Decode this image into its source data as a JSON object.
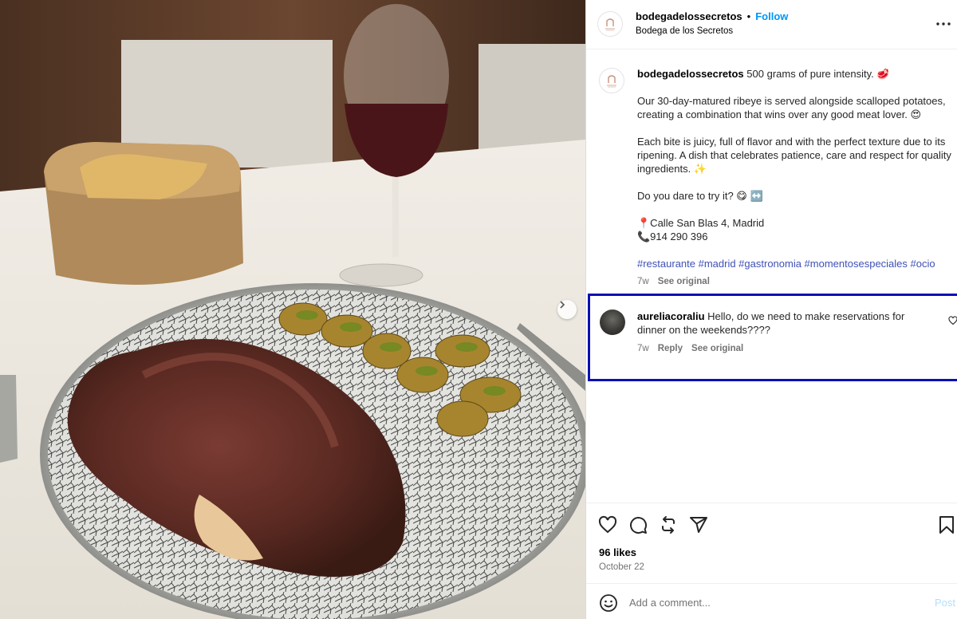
{
  "post": {
    "username": "bodegadelossecretos",
    "separator": "•",
    "follow_label": "Follow",
    "location": "Bodega de los Secretos",
    "more_icon": "more-horizontal-icon"
  },
  "caption": {
    "username": "bodegadelossecretos",
    "first_line": "500 grams of pure intensity. 🥩",
    "para1": "Our 30-day-matured ribeye is served alongside scalloped potatoes, creating a combination that wins over any good meat lover. 😍",
    "para2": "Each bite is juicy, full of flavor and with the perfect texture due to its ripening. A dish that celebrates patience, care and respect for quality ingredients. ✨",
    "para3": "Do you dare to try it? 😋 ↔️",
    "address": "📍Calle San Blas 4, Madrid",
    "phone": "📞914 290 396",
    "hashtags": "#restaurante #madrid #gastronomia #momentosespeciales #ocio",
    "time": "7w",
    "see_original": "See original"
  },
  "comment": {
    "username": "aureliacoraliu",
    "text": "Hello, do we need to make reservations for dinner on the weekends????",
    "time": "7w",
    "reply": "Reply",
    "see_original": "See original"
  },
  "actions": {
    "icons": [
      "heart-icon",
      "comment-icon",
      "repost-icon",
      "share-icon",
      "bookmark-icon"
    ],
    "likes": "96 likes",
    "date": "October 22"
  },
  "add_comment": {
    "placeholder": "Add a comment...",
    "post_label": "Post"
  },
  "colors": {
    "accent": "#0095f6",
    "highlight_border": "#0a0fb5",
    "muted": "#737373"
  }
}
